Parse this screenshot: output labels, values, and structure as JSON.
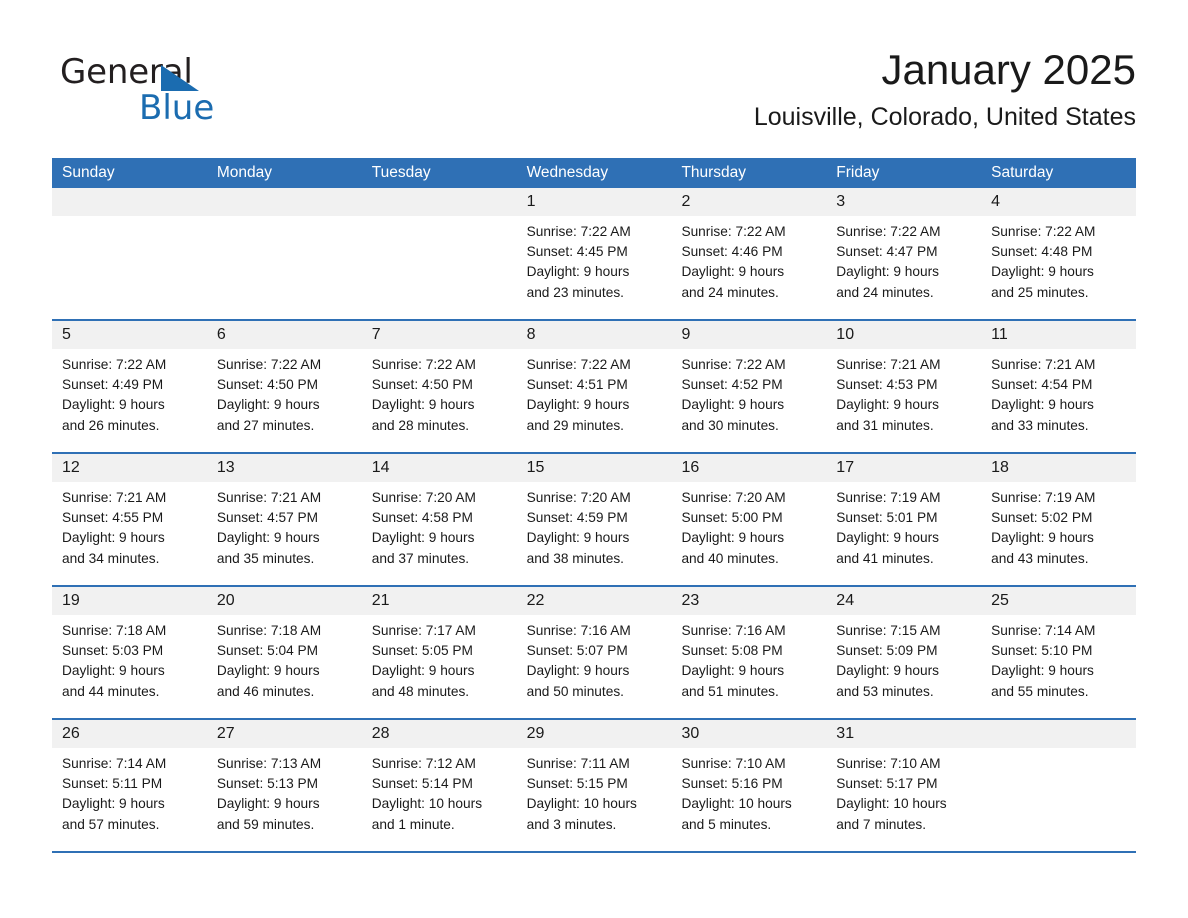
{
  "brand": {
    "name_part1": "General",
    "name_part2": "Blue",
    "accent_color": "#1b6cb0"
  },
  "header": {
    "title": "January 2025",
    "subtitle": "Louisville, Colorado, United States"
  },
  "calendar": {
    "header_bg": "#2f70b5",
    "day_band_bg": "#f1f1f1",
    "weekdays": [
      "Sunday",
      "Monday",
      "Tuesday",
      "Wednesday",
      "Thursday",
      "Friday",
      "Saturday"
    ],
    "weeks": [
      [
        {
          "day": "",
          "sunrise": "",
          "sunset": "",
          "daylight_line1": "",
          "daylight_line2": "",
          "empty": true
        },
        {
          "day": "",
          "sunrise": "",
          "sunset": "",
          "daylight_line1": "",
          "daylight_line2": "",
          "empty": true
        },
        {
          "day": "",
          "sunrise": "",
          "sunset": "",
          "daylight_line1": "",
          "daylight_line2": "",
          "empty": true
        },
        {
          "day": "1",
          "sunrise": "Sunrise: 7:22 AM",
          "sunset": "Sunset: 4:45 PM",
          "daylight_line1": "Daylight: 9 hours",
          "daylight_line2": "and 23 minutes."
        },
        {
          "day": "2",
          "sunrise": "Sunrise: 7:22 AM",
          "sunset": "Sunset: 4:46 PM",
          "daylight_line1": "Daylight: 9 hours",
          "daylight_line2": "and 24 minutes."
        },
        {
          "day": "3",
          "sunrise": "Sunrise: 7:22 AM",
          "sunset": "Sunset: 4:47 PM",
          "daylight_line1": "Daylight: 9 hours",
          "daylight_line2": "and 24 minutes."
        },
        {
          "day": "4",
          "sunrise": "Sunrise: 7:22 AM",
          "sunset": "Sunset: 4:48 PM",
          "daylight_line1": "Daylight: 9 hours",
          "daylight_line2": "and 25 minutes."
        }
      ],
      [
        {
          "day": "5",
          "sunrise": "Sunrise: 7:22 AM",
          "sunset": "Sunset: 4:49 PM",
          "daylight_line1": "Daylight: 9 hours",
          "daylight_line2": "and 26 minutes."
        },
        {
          "day": "6",
          "sunrise": "Sunrise: 7:22 AM",
          "sunset": "Sunset: 4:50 PM",
          "daylight_line1": "Daylight: 9 hours",
          "daylight_line2": "and 27 minutes."
        },
        {
          "day": "7",
          "sunrise": "Sunrise: 7:22 AM",
          "sunset": "Sunset: 4:50 PM",
          "daylight_line1": "Daylight: 9 hours",
          "daylight_line2": "and 28 minutes."
        },
        {
          "day": "8",
          "sunrise": "Sunrise: 7:22 AM",
          "sunset": "Sunset: 4:51 PM",
          "daylight_line1": "Daylight: 9 hours",
          "daylight_line2": "and 29 minutes."
        },
        {
          "day": "9",
          "sunrise": "Sunrise: 7:22 AM",
          "sunset": "Sunset: 4:52 PM",
          "daylight_line1": "Daylight: 9 hours",
          "daylight_line2": "and 30 minutes."
        },
        {
          "day": "10",
          "sunrise": "Sunrise: 7:21 AM",
          "sunset": "Sunset: 4:53 PM",
          "daylight_line1": "Daylight: 9 hours",
          "daylight_line2": "and 31 minutes."
        },
        {
          "day": "11",
          "sunrise": "Sunrise: 7:21 AM",
          "sunset": "Sunset: 4:54 PM",
          "daylight_line1": "Daylight: 9 hours",
          "daylight_line2": "and 33 minutes."
        }
      ],
      [
        {
          "day": "12",
          "sunrise": "Sunrise: 7:21 AM",
          "sunset": "Sunset: 4:55 PM",
          "daylight_line1": "Daylight: 9 hours",
          "daylight_line2": "and 34 minutes."
        },
        {
          "day": "13",
          "sunrise": "Sunrise: 7:21 AM",
          "sunset": "Sunset: 4:57 PM",
          "daylight_line1": "Daylight: 9 hours",
          "daylight_line2": "and 35 minutes."
        },
        {
          "day": "14",
          "sunrise": "Sunrise: 7:20 AM",
          "sunset": "Sunset: 4:58 PM",
          "daylight_line1": "Daylight: 9 hours",
          "daylight_line2": "and 37 minutes."
        },
        {
          "day": "15",
          "sunrise": "Sunrise: 7:20 AM",
          "sunset": "Sunset: 4:59 PM",
          "daylight_line1": "Daylight: 9 hours",
          "daylight_line2": "and 38 minutes."
        },
        {
          "day": "16",
          "sunrise": "Sunrise: 7:20 AM",
          "sunset": "Sunset: 5:00 PM",
          "daylight_line1": "Daylight: 9 hours",
          "daylight_line2": "and 40 minutes."
        },
        {
          "day": "17",
          "sunrise": "Sunrise: 7:19 AM",
          "sunset": "Sunset: 5:01 PM",
          "daylight_line1": "Daylight: 9 hours",
          "daylight_line2": "and 41 minutes."
        },
        {
          "day": "18",
          "sunrise": "Sunrise: 7:19 AM",
          "sunset": "Sunset: 5:02 PM",
          "daylight_line1": "Daylight: 9 hours",
          "daylight_line2": "and 43 minutes."
        }
      ],
      [
        {
          "day": "19",
          "sunrise": "Sunrise: 7:18 AM",
          "sunset": "Sunset: 5:03 PM",
          "daylight_line1": "Daylight: 9 hours",
          "daylight_line2": "and 44 minutes."
        },
        {
          "day": "20",
          "sunrise": "Sunrise: 7:18 AM",
          "sunset": "Sunset: 5:04 PM",
          "daylight_line1": "Daylight: 9 hours",
          "daylight_line2": "and 46 minutes."
        },
        {
          "day": "21",
          "sunrise": "Sunrise: 7:17 AM",
          "sunset": "Sunset: 5:05 PM",
          "daylight_line1": "Daylight: 9 hours",
          "daylight_line2": "and 48 minutes."
        },
        {
          "day": "22",
          "sunrise": "Sunrise: 7:16 AM",
          "sunset": "Sunset: 5:07 PM",
          "daylight_line1": "Daylight: 9 hours",
          "daylight_line2": "and 50 minutes."
        },
        {
          "day": "23",
          "sunrise": "Sunrise: 7:16 AM",
          "sunset": "Sunset: 5:08 PM",
          "daylight_line1": "Daylight: 9 hours",
          "daylight_line2": "and 51 minutes."
        },
        {
          "day": "24",
          "sunrise": "Sunrise: 7:15 AM",
          "sunset": "Sunset: 5:09 PM",
          "daylight_line1": "Daylight: 9 hours",
          "daylight_line2": "and 53 minutes."
        },
        {
          "day": "25",
          "sunrise": "Sunrise: 7:14 AM",
          "sunset": "Sunset: 5:10 PM",
          "daylight_line1": "Daylight: 9 hours",
          "daylight_line2": "and 55 minutes."
        }
      ],
      [
        {
          "day": "26",
          "sunrise": "Sunrise: 7:14 AM",
          "sunset": "Sunset: 5:11 PM",
          "daylight_line1": "Daylight: 9 hours",
          "daylight_line2": "and 57 minutes."
        },
        {
          "day": "27",
          "sunrise": "Sunrise: 7:13 AM",
          "sunset": "Sunset: 5:13 PM",
          "daylight_line1": "Daylight: 9 hours",
          "daylight_line2": "and 59 minutes."
        },
        {
          "day": "28",
          "sunrise": "Sunrise: 7:12 AM",
          "sunset": "Sunset: 5:14 PM",
          "daylight_line1": "Daylight: 10 hours",
          "daylight_line2": "and 1 minute."
        },
        {
          "day": "29",
          "sunrise": "Sunrise: 7:11 AM",
          "sunset": "Sunset: 5:15 PM",
          "daylight_line1": "Daylight: 10 hours",
          "daylight_line2": "and 3 minutes."
        },
        {
          "day": "30",
          "sunrise": "Sunrise: 7:10 AM",
          "sunset": "Sunset: 5:16 PM",
          "daylight_line1": "Daylight: 10 hours",
          "daylight_line2": "and 5 minutes."
        },
        {
          "day": "31",
          "sunrise": "Sunrise: 7:10 AM",
          "sunset": "Sunset: 5:17 PM",
          "daylight_line1": "Daylight: 10 hours",
          "daylight_line2": "and 7 minutes."
        },
        {
          "day": "",
          "sunrise": "",
          "sunset": "",
          "daylight_line1": "",
          "daylight_line2": "",
          "empty": true
        }
      ]
    ]
  }
}
